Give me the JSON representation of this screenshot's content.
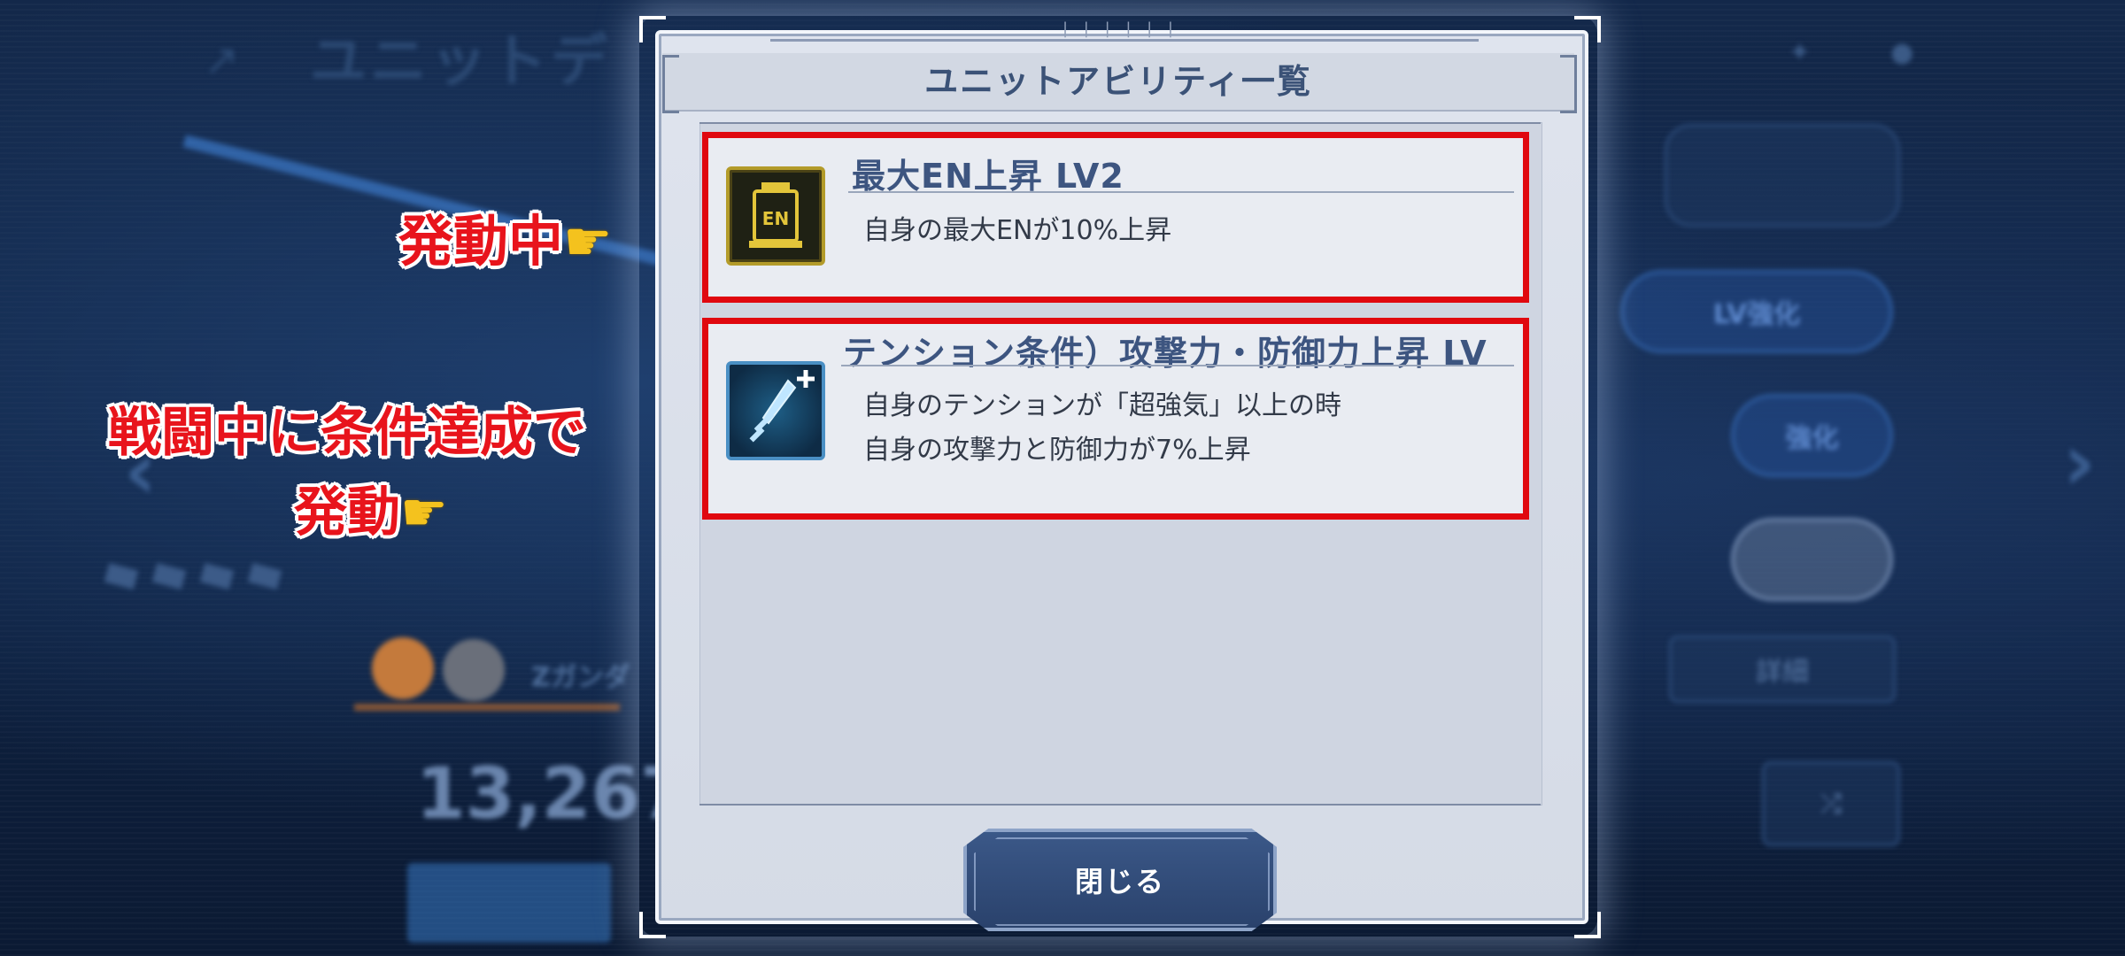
{
  "background": {
    "screen_title": "ユニットデ",
    "unit_name": "Zガンダ",
    "power_value": "13,267",
    "lv_button": "LV強化",
    "enhance_button": "強化",
    "detail_button": "詳細"
  },
  "dialog": {
    "title": "ユニットアビリティ一覧",
    "close_label": "閉じる"
  },
  "abilities": [
    {
      "icon": "en-canister-icon",
      "icon_text": "EN",
      "name": "最大EN上昇 LV2",
      "desc_line1": "自身の最大ENが10%上昇",
      "desc_line2": ""
    },
    {
      "icon": "sword-plus-icon",
      "icon_text": "",
      "name": "テンション条件）攻撃力・防御力上昇 LV",
      "desc_line1": "自身のテンションが「超強気」以上の時",
      "desc_line2": "自身の攻撃力と防御力が7%上昇"
    }
  ],
  "annotations": {
    "active_label": "発動中",
    "conditional_line1": "戦闘中に条件達成で",
    "conditional_line2": "発動"
  },
  "colors": {
    "highlight_red": "#e0080f",
    "dialog_bg": "#dfe4ee",
    "title_blue": "#3b5277",
    "button_blue": "#2f4a78"
  }
}
